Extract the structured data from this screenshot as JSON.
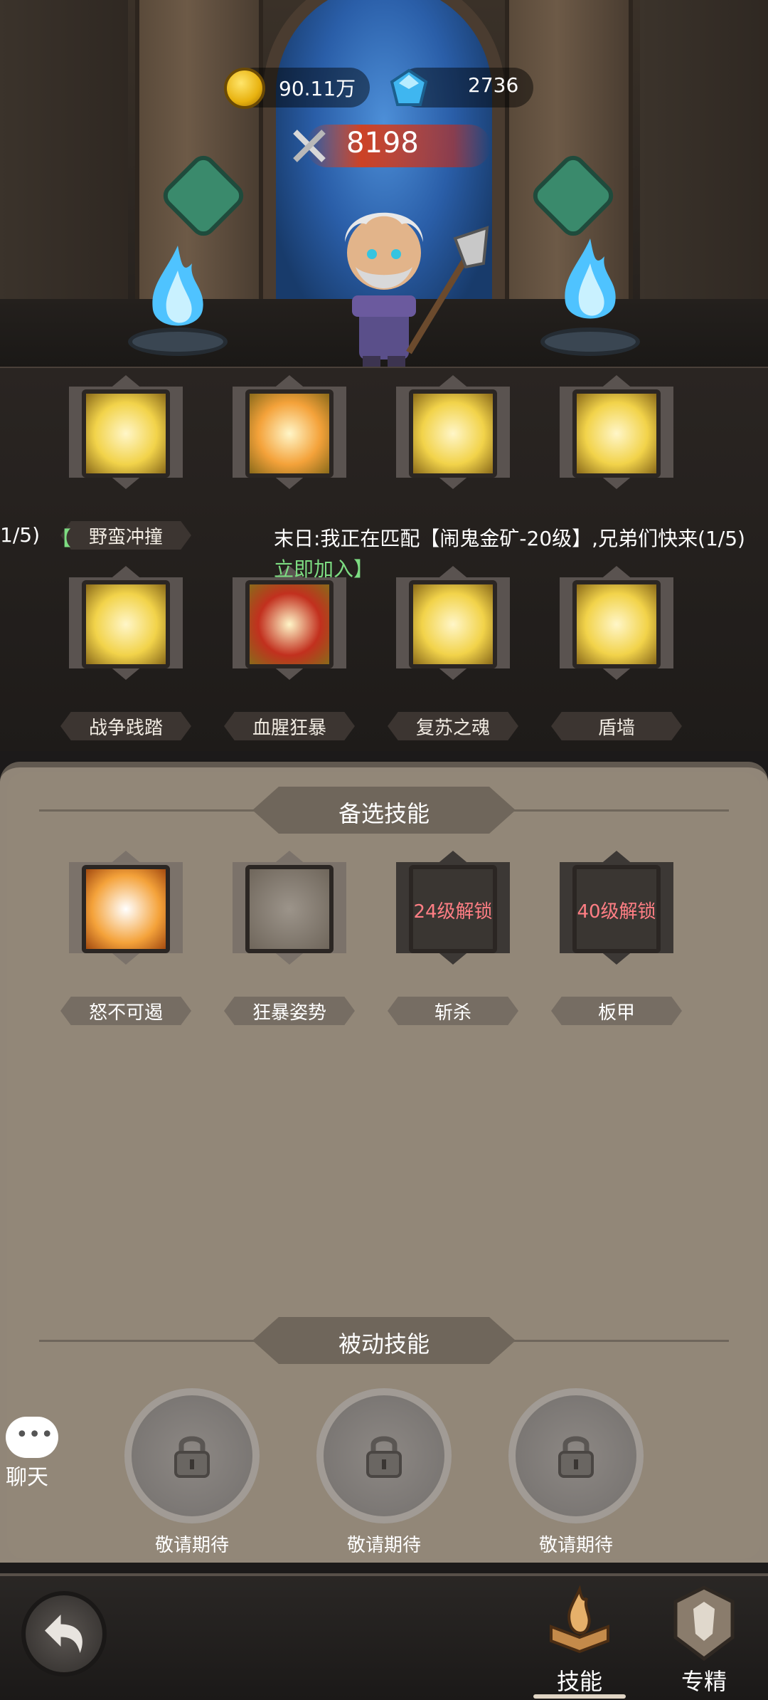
{
  "currency": {
    "gold_value": "90.11万",
    "gem_value": "2736"
  },
  "power": {
    "value": "8198"
  },
  "equipped_skills": [
    {
      "label": "野蛮冲撞",
      "icon": "axe-charge-icon",
      "color": "#f2d34a"
    },
    {
      "label": "",
      "icon": "cleave-icon",
      "color": "#f4a23a"
    },
    {
      "label": "",
      "icon": "blade-strike-icon",
      "color": "#f2d34a"
    },
    {
      "label": "",
      "icon": "battle-cry-icon",
      "color": "#f2d34a"
    },
    {
      "label": "战争践踏",
      "icon": "war-stomp-icon",
      "color": "#f2d34a"
    },
    {
      "label": "血腥狂暴",
      "icon": "skull-rage-icon",
      "color": "#c2301e"
    },
    {
      "label": "复苏之魂",
      "icon": "revive-soul-icon",
      "color": "#f2d34a"
    },
    {
      "label": "盾墙",
      "icon": "shield-wall-icon",
      "color": "#f2d34a"
    }
  ],
  "ticker": {
    "left_text": "1/5)",
    "left_bracket": "【",
    "main_text": "末日:我正在匹配【闹鬼金矿-20级】,兄弟们快来(1/5)",
    "join_text": "立即加入】"
  },
  "alternate_section": {
    "title": "备选技能",
    "skills": [
      {
        "label": "怒不可遏",
        "icon": "fury-icon",
        "locked": false,
        "lock_text": ""
      },
      {
        "label": "狂暴姿势",
        "icon": "crossed-swords-icon",
        "locked": false,
        "lock_text": ""
      },
      {
        "label": "斩杀",
        "icon": "execute-icon",
        "locked": true,
        "lock_text": "24级解锁"
      },
      {
        "label": "板甲",
        "icon": "plate-armor-icon",
        "locked": true,
        "lock_text": "40级解锁"
      }
    ]
  },
  "passive_section": {
    "title": "被动技能",
    "slots": [
      {
        "label": "敬请期待"
      },
      {
        "label": "敬请期待"
      },
      {
        "label": "敬请期待"
      }
    ]
  },
  "chat": {
    "label": "聊天",
    "dots": "•••"
  },
  "nav": {
    "tabs": [
      {
        "label": "技能",
        "active": true
      },
      {
        "label": "专精",
        "active": false
      }
    ]
  },
  "colors": {
    "panel_bg": "#928778",
    "lock_text": "#ff7e84",
    "ticker_green": "#7ddc82",
    "skill_yellow": "#f2d34a"
  }
}
